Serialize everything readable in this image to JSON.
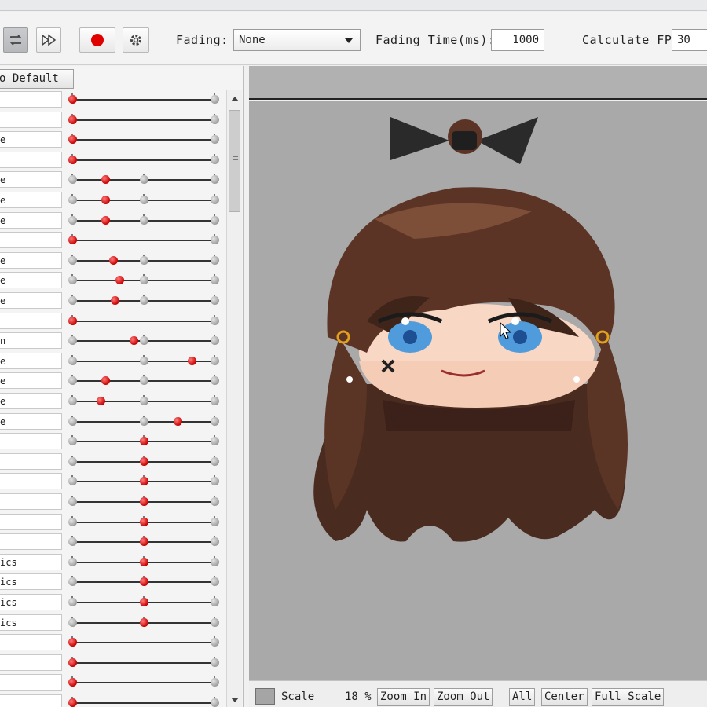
{
  "toolbar": {
    "fading_label": "Fading:",
    "fading_value": "None",
    "fading_time_label": "Fading Time(ms):",
    "fading_time_value": "1000",
    "fps_label": "Calculate FPS",
    "fps_value": "30"
  },
  "left": {
    "default_button": "o Default",
    "rows": [
      {
        "label": "",
        "value": 0.0
      },
      {
        "label": "",
        "value": 0.0
      },
      {
        "label": "e",
        "value": 0.0
      },
      {
        "label": "",
        "value": 0.0
      },
      {
        "label": "e",
        "value": 0.23
      },
      {
        "label": "e",
        "value": 0.23
      },
      {
        "label": "e",
        "value": 0.23
      },
      {
        "label": "",
        "value": 0.0
      },
      {
        "label": "e",
        "value": 0.29
      },
      {
        "label": "e",
        "value": 0.33
      },
      {
        "label": "e",
        "value": 0.3
      },
      {
        "label": "",
        "value": 0.0
      },
      {
        "label": "n",
        "value": 0.43
      },
      {
        "label": "e",
        "value": 0.84
      },
      {
        "label": "e",
        "value": 0.23
      },
      {
        "label": "e",
        "value": 0.2
      },
      {
        "label": "e",
        "value": 0.74
      },
      {
        "label": "",
        "value": 0.5
      },
      {
        "label": "",
        "value": 0.5
      },
      {
        "label": "",
        "value": 0.5
      },
      {
        "label": "",
        "value": 0.5
      },
      {
        "label": "",
        "value": 0.5
      },
      {
        "label": "",
        "value": 0.5
      },
      {
        "label": "ics",
        "value": 0.5
      },
      {
        "label": "ics",
        "value": 0.5
      },
      {
        "label": "ics",
        "value": 0.5
      },
      {
        "label": "ics",
        "value": 0.5
      },
      {
        "label": "",
        "value": 0.0
      },
      {
        "label": "",
        "value": 0.0
      },
      {
        "label": "",
        "value": 0.0
      },
      {
        "label": "",
        "value": 0.0
      }
    ]
  },
  "viewer": {
    "scale_label": "Scale",
    "scale_value": "18 %",
    "zoom_in": "Zoom In",
    "zoom_out": "Zoom Out",
    "all": "All",
    "center": "Center",
    "full_scale": "Full Scale"
  },
  "colors": {
    "knob_active": "#c80000",
    "viewer_bg": "#a9a9a9",
    "hair": "#4a2b1f",
    "eyes": "#4f9bdc"
  }
}
